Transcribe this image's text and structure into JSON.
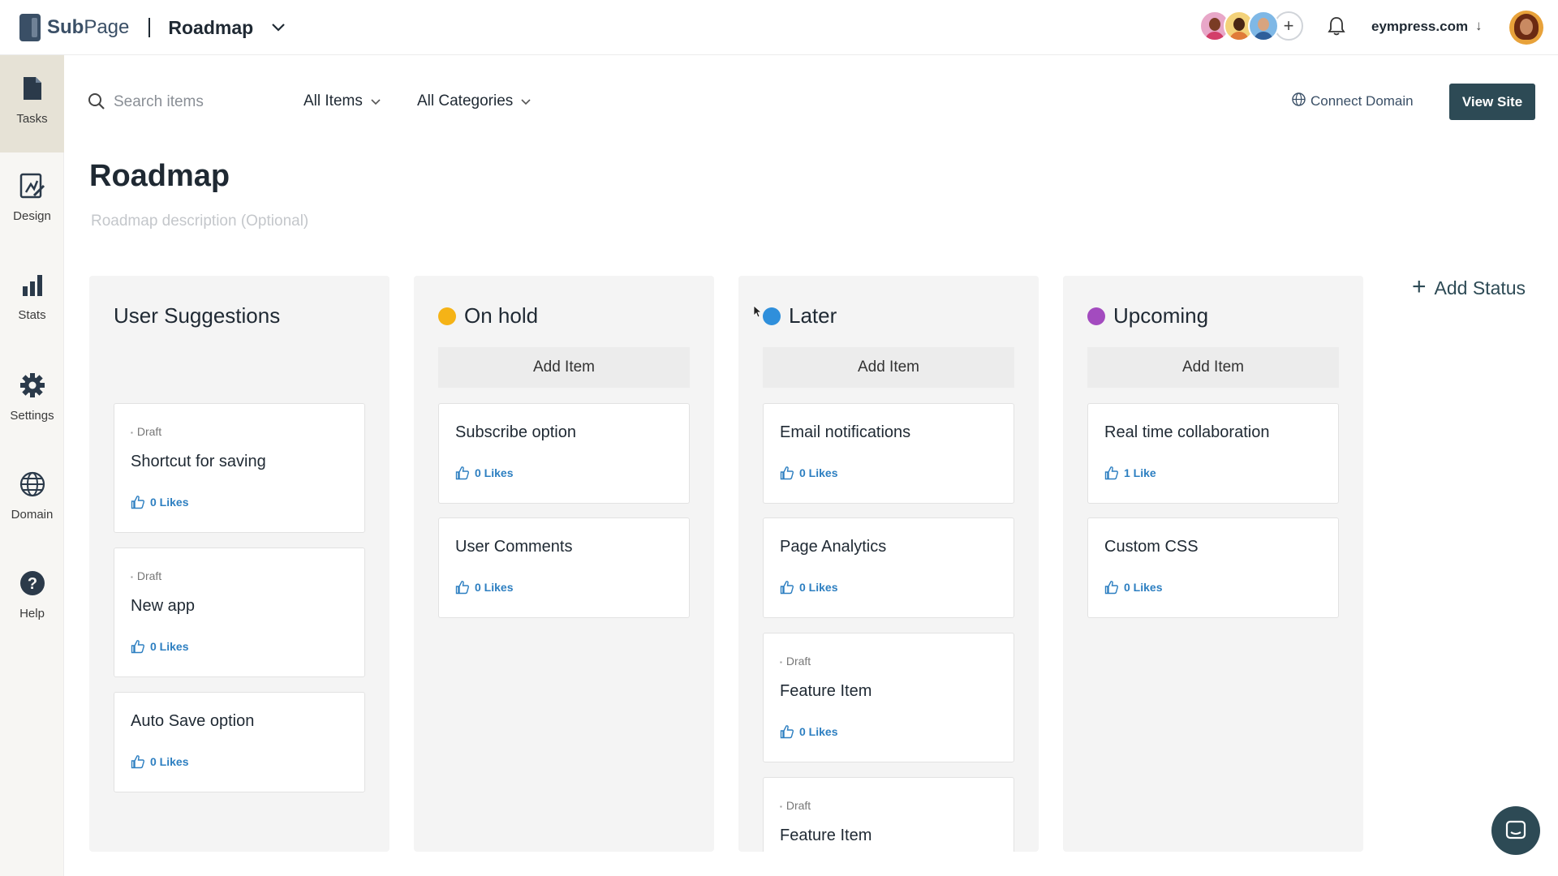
{
  "app": {
    "brand": "SubPage",
    "brand_bold": "Sub",
    "brand_rest": "Page",
    "section_title": "Roadmap"
  },
  "header": {
    "domain": "eympress.com",
    "collaborator_add": "+"
  },
  "sidebar": {
    "items": [
      {
        "label": "Tasks",
        "icon": "document-icon",
        "active": true
      },
      {
        "label": "Design",
        "icon": "design-icon",
        "active": false
      },
      {
        "label": "Stats",
        "icon": "bar-chart-icon",
        "active": false
      },
      {
        "label": "Settings",
        "icon": "gear-icon",
        "active": false
      },
      {
        "label": "Domain",
        "icon": "globe-icon",
        "active": false
      },
      {
        "label": "Help",
        "icon": "help-icon",
        "active": false
      }
    ]
  },
  "filters": {
    "search_placeholder": "Search items",
    "items_filter": "All Items",
    "categories_filter": "All Categories",
    "connect_domain": "Connect Domain",
    "view_site": "View Site"
  },
  "page": {
    "title": "Roadmap",
    "description_placeholder": "Roadmap description (Optional)"
  },
  "columns": [
    {
      "title": "User Suggestions",
      "dot_color": "",
      "add_item": "",
      "cards": [
        {
          "draft": "Draft",
          "title": "Shortcut for saving",
          "likes": "0 Likes"
        },
        {
          "draft": "Draft",
          "title": "New app",
          "likes": "0 Likes"
        },
        {
          "draft": "",
          "title": "Auto Save option",
          "likes": "0 Likes"
        }
      ]
    },
    {
      "title": "On hold",
      "dot_color": "#f5b316",
      "add_item": "Add Item",
      "cards": [
        {
          "draft": "",
          "title": "Subscribe option",
          "likes": "0 Likes"
        },
        {
          "draft": "",
          "title": "User Comments",
          "likes": "0 Likes"
        }
      ]
    },
    {
      "title": "Later",
      "dot_color": "#2f8fdb",
      "add_item": "Add Item",
      "cards": [
        {
          "draft": "",
          "title": "Email notifications",
          "likes": "0 Likes"
        },
        {
          "draft": "",
          "title": "Page Analytics",
          "likes": "0 Likes"
        },
        {
          "draft": "Draft",
          "title": "Feature Item",
          "likes": "0 Likes"
        },
        {
          "draft": "Draft",
          "title": "Feature Item",
          "likes": ""
        }
      ]
    },
    {
      "title": "Upcoming",
      "dot_color": "#a34bbf",
      "add_item": "Add Item",
      "cards": [
        {
          "draft": "",
          "title": "Real time collaboration",
          "likes": "1 Like"
        },
        {
          "draft": "",
          "title": "Custom CSS",
          "likes": "0 Likes"
        }
      ]
    }
  ],
  "add_status": "Add Status",
  "colors": {
    "accent": "#2d4a55",
    "link": "#2d7fc1",
    "sidebar_active": "#e6e2d6"
  }
}
